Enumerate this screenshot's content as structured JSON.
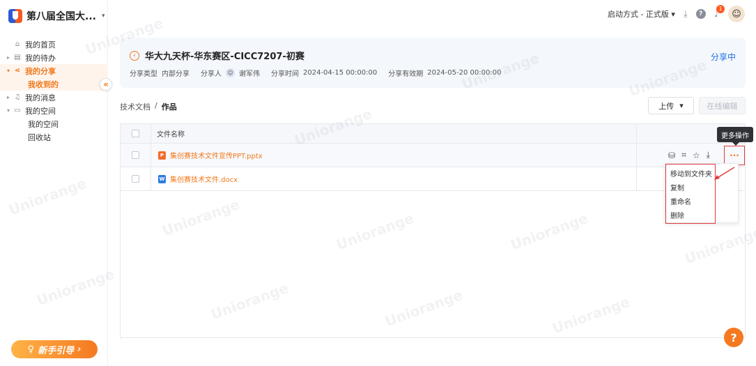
{
  "app": {
    "title": "第八届全国大...",
    "title_caret": "▾"
  },
  "sidebar": {
    "items": [
      {
        "label": "我的首页",
        "icon": "home-icon",
        "glyph": "⌂",
        "arrow": ""
      },
      {
        "label": "我的待办",
        "icon": "todo-icon",
        "glyph": "▤",
        "arrow": "▸"
      },
      {
        "label": "我的分享",
        "icon": "share-icon",
        "glyph": "⋖",
        "arrow": "▾"
      },
      {
        "label": "我收到的",
        "sub": true
      },
      {
        "label": "我的消息",
        "icon": "bell-icon",
        "glyph": "♫",
        "arrow": "▸"
      },
      {
        "label": "我的空间",
        "icon": "space-icon",
        "glyph": "▭",
        "arrow": "▾"
      },
      {
        "label": "我的空间",
        "sub": true
      },
      {
        "label": "回收站",
        "sub": true
      }
    ],
    "collapse_glyph": "«",
    "guide_label": "新手引导",
    "guide_arrow": "›",
    "guide_icon": "♀"
  },
  "topbar": {
    "launch_mode": "启动方式 - 正式版",
    "launch_caret": "▾",
    "download_icon": "⤓",
    "help_glyph": "?",
    "bell_glyph": "♪",
    "notification_count": "1",
    "avatar_glyph": "☺"
  },
  "info": {
    "back_glyph": "‹",
    "title": "华大九天杯-华东赛区-CICC7207-初赛",
    "status": "分享中",
    "share_type_label": "分享类型",
    "share_type_value": "内部分享",
    "sharer_label": "分享人",
    "sharer_value": "谢军伟",
    "share_time_label": "分享时间",
    "share_time_value": "2024-04-15 00:00:00",
    "valid_until_label": "分享有效期",
    "valid_until_value": "2024-05-20 00:00:00"
  },
  "breadcrumb": {
    "parent": "技术文档",
    "separator": "/",
    "current": "作品"
  },
  "toolbar": {
    "upload_label": "上传",
    "upload_caret": "▾",
    "edit_label": "在线编辑"
  },
  "table": {
    "header_name": "文件名称",
    "rows": [
      {
        "name": "集创赛技术文件宣传PPT.pptx",
        "type": "ppt",
        "badge": "P"
      },
      {
        "name": "集创赛技术文件.docx",
        "type": "doc",
        "badge": "W"
      }
    ],
    "row_actions": {
      "share": "⛁",
      "link": "⌗",
      "star": "☆",
      "download": "⤓",
      "more": "···"
    }
  },
  "tooltip": "更多操作",
  "dropdown": [
    "移动到文件夹",
    "复制",
    "重命名",
    "删除"
  ],
  "watermark": "Uniorange",
  "help_fab": "?"
}
